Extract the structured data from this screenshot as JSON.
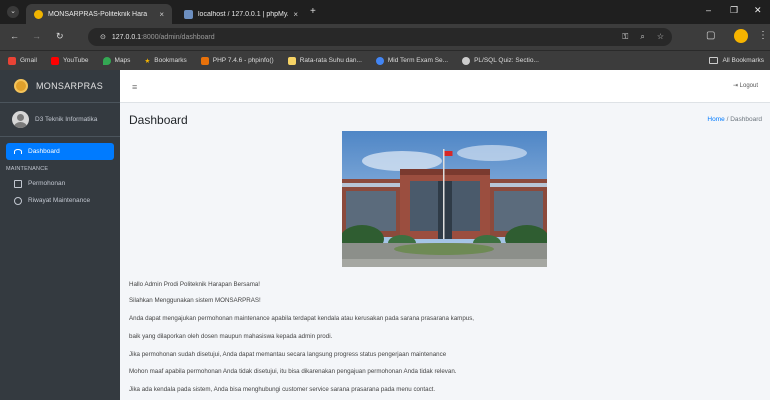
{
  "browser": {
    "tabs": [
      {
        "title": "MONSARPRAS-Politeknik Hara",
        "close": "×"
      },
      {
        "title": "localhost / 127.0.0.1 | phpMyAc",
        "close": "×"
      }
    ],
    "new_tab": "+",
    "url_host": "127.0.0.1",
    "url_path": ":8000/admin/dashboard",
    "bookmarks": [
      {
        "label": "Gmail",
        "color": "#ea4335"
      },
      {
        "label": "YouTube",
        "color": "#ff0000"
      },
      {
        "label": "Maps",
        "color": "#34a853"
      },
      {
        "label": "Bookmarks",
        "color": "#f4b400"
      },
      {
        "label": "PHP 7.4.6 - phpinfo()",
        "color": "#e8710a"
      },
      {
        "label": "Rata-rata Suhu dan...",
        "color": "#f6d365"
      },
      {
        "label": "Mid Term Exam Se...",
        "color": "#4285f4"
      },
      {
        "label": "PL/SQL Quiz: Sectio...",
        "color": "#cccccc"
      }
    ],
    "all_bookmarks": "All Bookmarks"
  },
  "sidebar": {
    "brand": "MONSARPRAS",
    "user": "D3 Teknik Informatika",
    "items": [
      {
        "label": "Dashboard",
        "icon": "dashboard-icon"
      }
    ],
    "section_header": "MAINTENANCE",
    "maintenance_items": [
      {
        "label": "Permohonan",
        "icon": "edit-icon"
      },
      {
        "label": "Riwayat Maintenance",
        "icon": "history-icon"
      }
    ]
  },
  "topbar": {
    "menu_icon": "≡",
    "logout": "Logout"
  },
  "content": {
    "title": "Dashboard",
    "breadcrumb_home": "Home",
    "breadcrumb_sep": "/",
    "breadcrumb_current": "Dashboard",
    "paragraphs": [
      "Hallo Admin Prodi Politeknik Harapan Bersama!",
      "Silahkan Menggunakan sistem MONSARPRAS!",
      "Anda dapat mengajukan permohonan maintenance apabila terdapat kendala atau kerusakan pada sarana prasarana kampus,",
      "baik yang dilaporkan oleh dosen maupun mahasiswa kepada admin prodi.",
      "Jika permohonan sudah disetujui, Anda dapat memantau secara langsung progress status pengerjaan maintenance",
      "Mohon maaf apabila permohonan Anda tidak disetujui, itu bisa dikarenakan pengajuan permohonan Anda tidak relevan.",
      "Jika ada kendala pada sistem, Anda bisa menghubungi customer service sarana prasarana pada menu contact."
    ]
  }
}
